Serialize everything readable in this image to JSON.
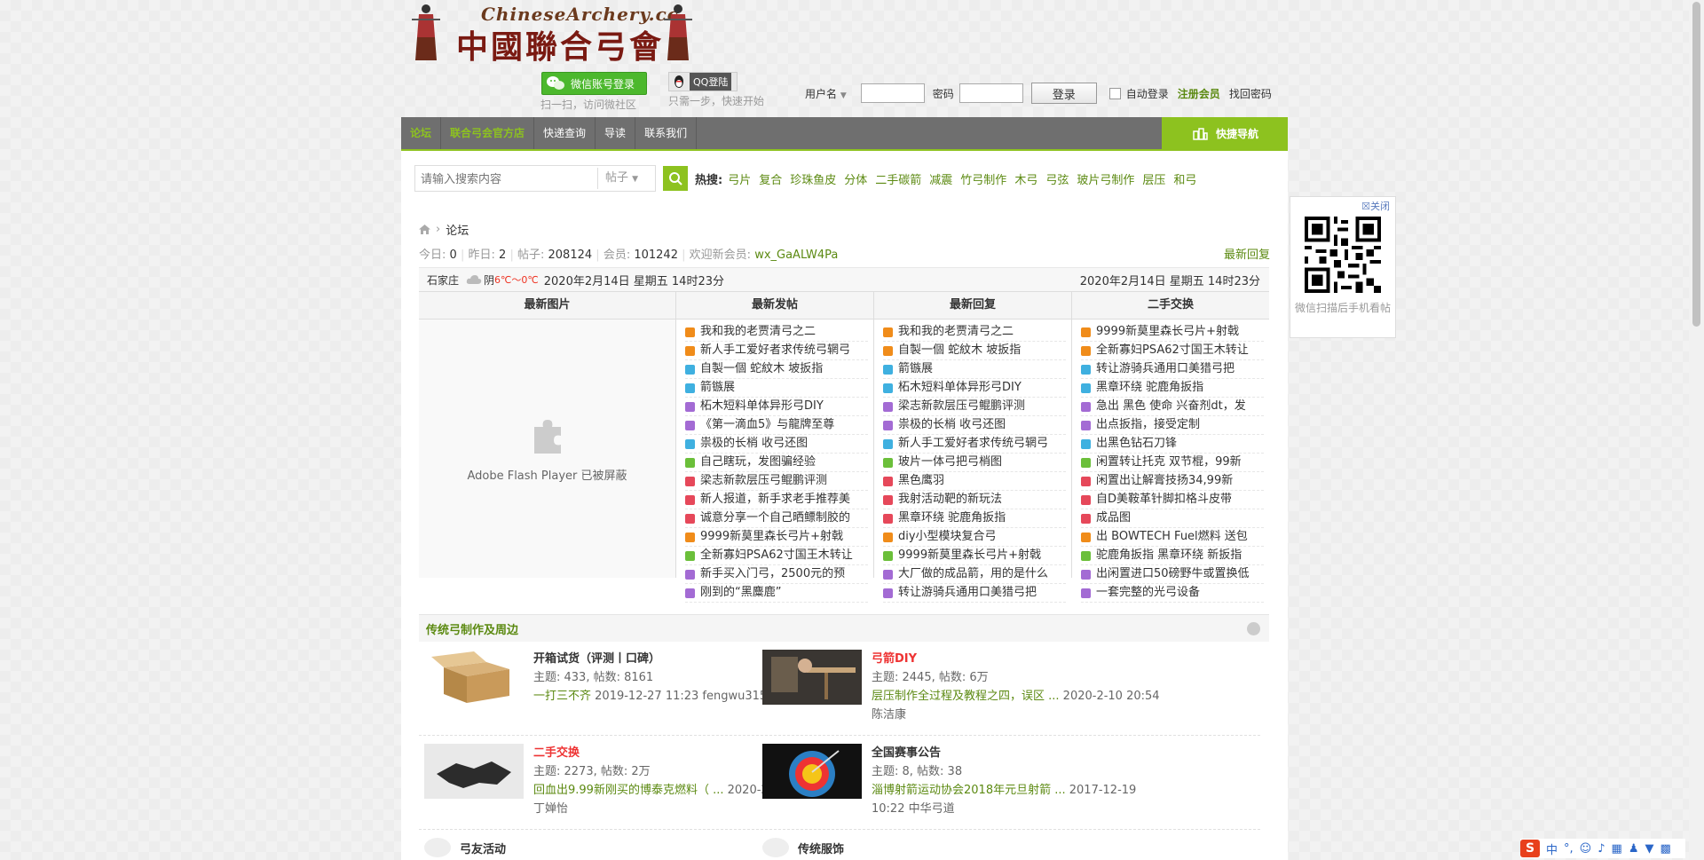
{
  "header": {
    "logo_title": "ChineseArchery.cc",
    "logo_cn": "中國聯合弓會",
    "wechat_login": "微信账号登录",
    "wechat_tip": "扫一扫，访问微社区",
    "qq_login": "QQ登陆",
    "qq_tip": "只需一步，快速开始",
    "username_label": "用户名",
    "password_label": "密码",
    "login_button": "登录",
    "auto_login": "自动登录",
    "register": "注册会员",
    "find_password": "找回密码"
  },
  "nav": {
    "items": [
      "论坛",
      "联合弓会官方店",
      "快递查询",
      "导读",
      "联系我们"
    ],
    "quick": "快捷导航"
  },
  "search": {
    "placeholder": "请输入搜索内容",
    "type": "帖子",
    "hot_label": "热搜:",
    "hot": [
      "弓片",
      "复合",
      "珍珠鱼皮",
      "分体",
      "二手碳箭",
      "减震",
      "竹弓制作",
      "木弓",
      "弓弦",
      "玻片弓制作",
      "层压",
      "和弓"
    ]
  },
  "breadcrumb": {
    "current": "论坛"
  },
  "stats": {
    "today_label": "今日:",
    "today": "0",
    "yesterday_label": "昨日:",
    "yesterday": "2",
    "posts_label": "帖子:",
    "posts": "208124",
    "members_label": "会员:",
    "members": "101242",
    "newmember_label": "欢迎新会员:",
    "newmember": "wx_GaALW4Pa",
    "latest_reply": "最新回复"
  },
  "weather": {
    "city": "石家庄",
    "cond": "阴",
    "temp": "6℃～0℃",
    "datetime": "2020年2月14日  星期五  14时23分",
    "datetime_right": "2020年2月14日  星期五  14时23分"
  },
  "grid": {
    "h1": "最新图片",
    "h2": "最新发帖",
    "h3": "最新回复",
    "h4": "二手交换",
    "flash": "Adobe Flash Player 已被屏蔽",
    "newposts": [
      "我和我的老贾清弓之二",
      "新人手工爱好者求传统弓辋弓",
      "自製一個 蛇紋木 坡扳指",
      "箭镞展",
      "柘木短料单体异形弓DIY",
      "《第一滴血5》与龍牌至尊",
      "祟极的长梢 收弓还图",
      "自己瞎玩，发图骗经验",
      "梁志新款层压弓鲲鹏评测",
      "新人报道，新手求老手推荐美",
      "诚意分享一个自己晒鳔制胶的",
      "9999新莫里森长弓片+射戟",
      "全新寡妇PSA62寸国王木转让",
      "新手买入门弓，2500元的预",
      "刚到的“黑麋鹿”"
    ],
    "newreplies": [
      "我和我的老贾清弓之二",
      "自製一個 蛇紋木 坡扳指",
      "箭镞展",
      "柘木短料单体异形弓DIY",
      "梁志新款层压弓鲲鹏评测",
      "祟极的长梢 收弓还图",
      "新人手工爱好者求传统弓辋弓",
      "玻片一体弓把弓梢图",
      "黑色鹰羽",
      "我射活动靶的新玩法",
      "黑章环绕 驼鹿角扳指",
      "diy小型模块复合弓",
      "9999新莫里森长弓片+射戟",
      "大厂做的成品箭，用的是什么",
      "转让游骑兵通用口美猎弓把"
    ],
    "trade": [
      "9999新莫里森长弓片+射戟",
      "全新寡妇PSA62寸国王木转让",
      "转让游骑兵通用口美猎弓把",
      "黑章环绕 驼鹿角扳指",
      "急出 黑色 使命 兴奋剂dt，发",
      "出点扳指，接受定制",
      "出黑色钻石刀锋",
      "闲置转让托克 双节棍，99新",
      "闲置出让解膏技扬34,99新",
      "自D美鞍革针脚扣格斗皮带",
      "成品图",
      "出 BOWTECH Fuel燃料 送包",
      "驼鹿角扳指 黑章环绕 新扳指",
      "出闲置进口50磅野牛或置换低",
      "一套完整的光弓设备"
    ]
  },
  "section": {
    "title": "传统弓制作及周边",
    "forums": [
      {
        "name": "开箱试货（评测丨口碑）",
        "meta": "主题: 433, 帖数: 8161",
        "last": "一打三不齐",
        "time": "2019-12-27 11:23 fengwu315",
        "time2": ""
      },
      {
        "name": "弓箭DIY",
        "meta": "主题: 2445, 帖数: 6万",
        "last": "层压制作全过程及教程之四，误区 ...",
        "time": "2020-2-10 20:54",
        "time2": "陈洁康"
      },
      {
        "name": "二手交换",
        "meta": "主题: 2273, 帖数: 2万",
        "last": "回血出9.99新刚买的博泰克燃料（ ...",
        "time": "2020-2-7 02:04",
        "time2": "丁婵怡"
      },
      {
        "name": "全国赛事公告",
        "meta": "主题: 8, 帖数: 38",
        "last": "淄博射箭运动协会2018年元旦射箭 ...",
        "time": "2017-12-19",
        "time2": "10:22 中华弓道"
      }
    ],
    "more": [
      "弓友活动",
      "传统服饰"
    ]
  },
  "qr": {
    "close": "关闭",
    "text": "微信扫描后手机看帖"
  },
  "ime": {
    "lang": "中"
  }
}
